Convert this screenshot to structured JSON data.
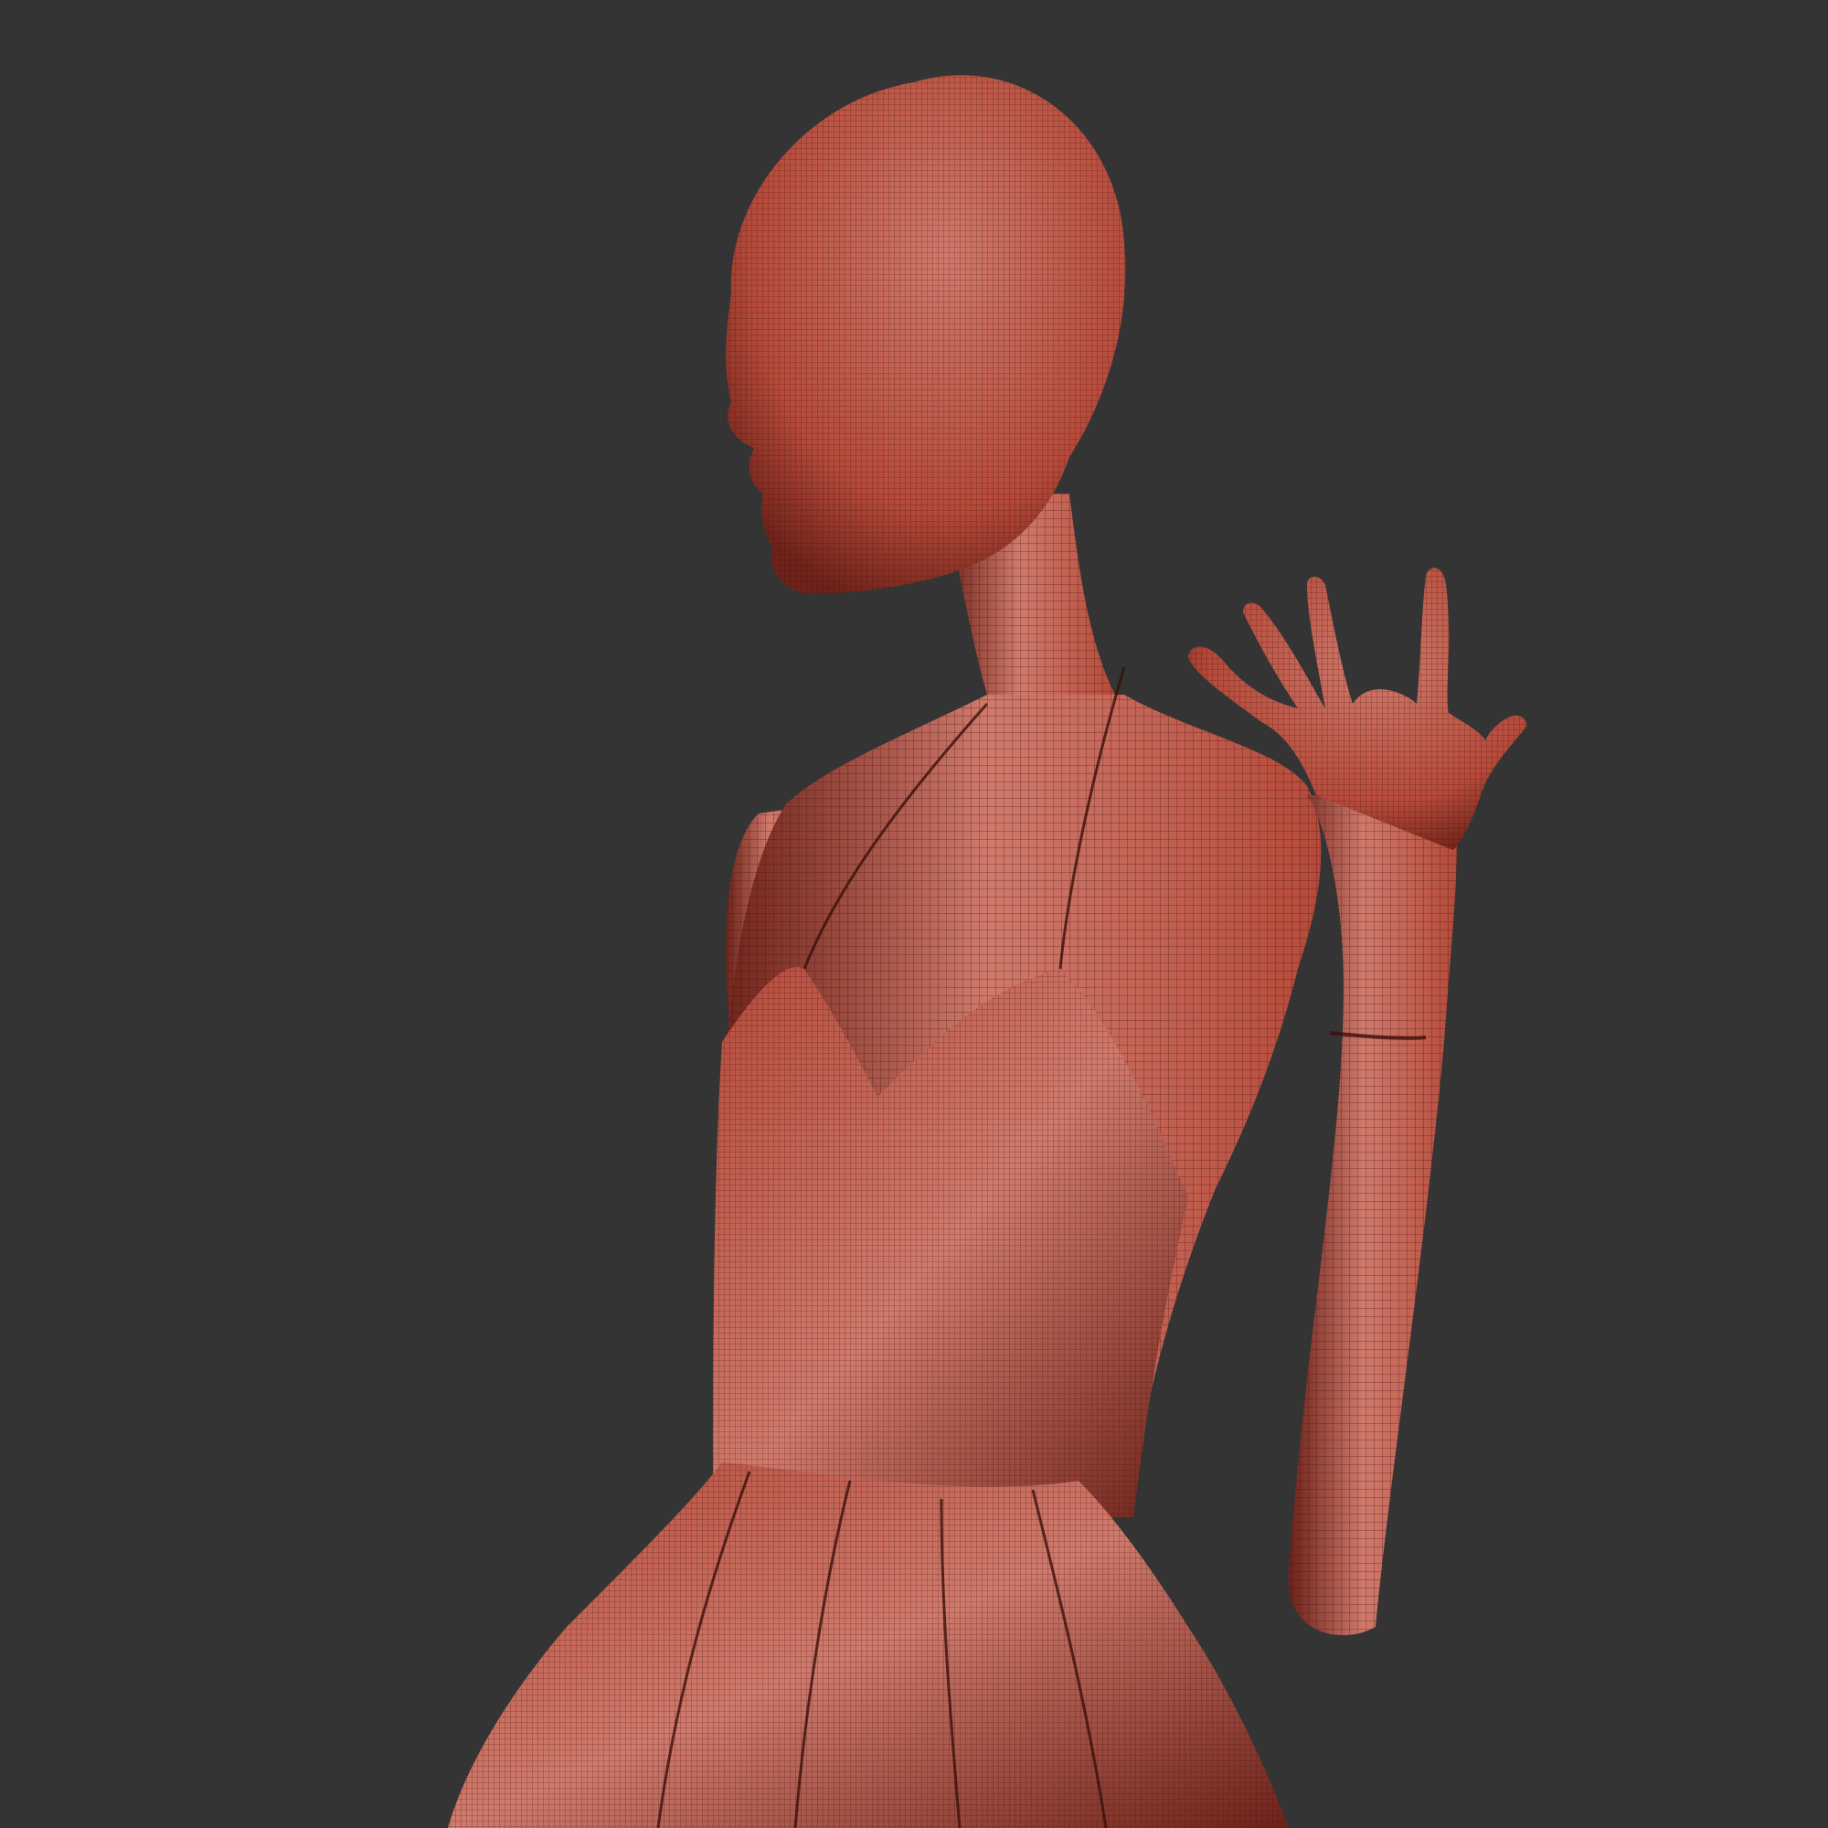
{
  "viewport": {
    "background_color": "#343434",
    "render_mode": "wireframe-overlay"
  },
  "model": {
    "subject": "mannequin-in-dress",
    "surface_color": "#b54a3a",
    "surface_highlight": "#cf7a6c",
    "surface_shadow": "#6e2219",
    "wire_color": "#3a0f0a"
  }
}
